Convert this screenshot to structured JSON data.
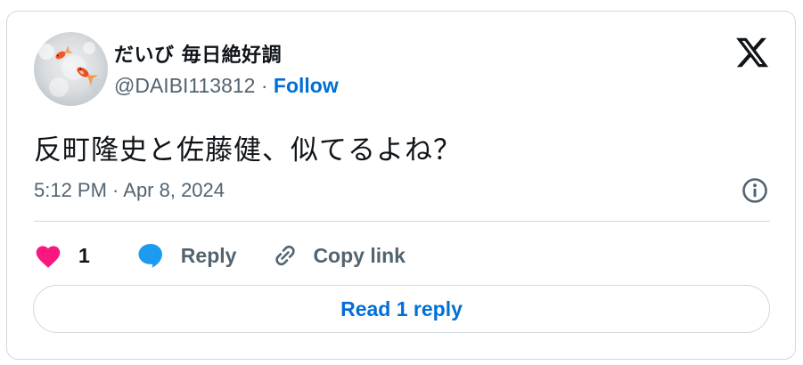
{
  "author": {
    "display_name": "だいび 毎日絶好調",
    "handle": "@DAIBI113812",
    "separator": "·",
    "follow_label": "Follow"
  },
  "tweet": {
    "text": "反町隆史と佐藤健、似てるよね？",
    "timestamp": "5:12 PM · Apr 8, 2024"
  },
  "actions": {
    "like_count": "1",
    "reply_label": "Reply",
    "copy_link_label": "Copy link"
  },
  "footer": {
    "read_replies_label": "Read 1 reply"
  },
  "icons": {
    "logo": "x-logo-icon",
    "info": "info-icon",
    "like": "heart-icon",
    "reply": "speech-bubble-icon",
    "copy_link": "link-icon"
  },
  "colors": {
    "accent": "#006fd6",
    "like": "#f91880",
    "reply": "#1d9bf0",
    "muted_text": "#536471",
    "border": "#cfd9de"
  }
}
